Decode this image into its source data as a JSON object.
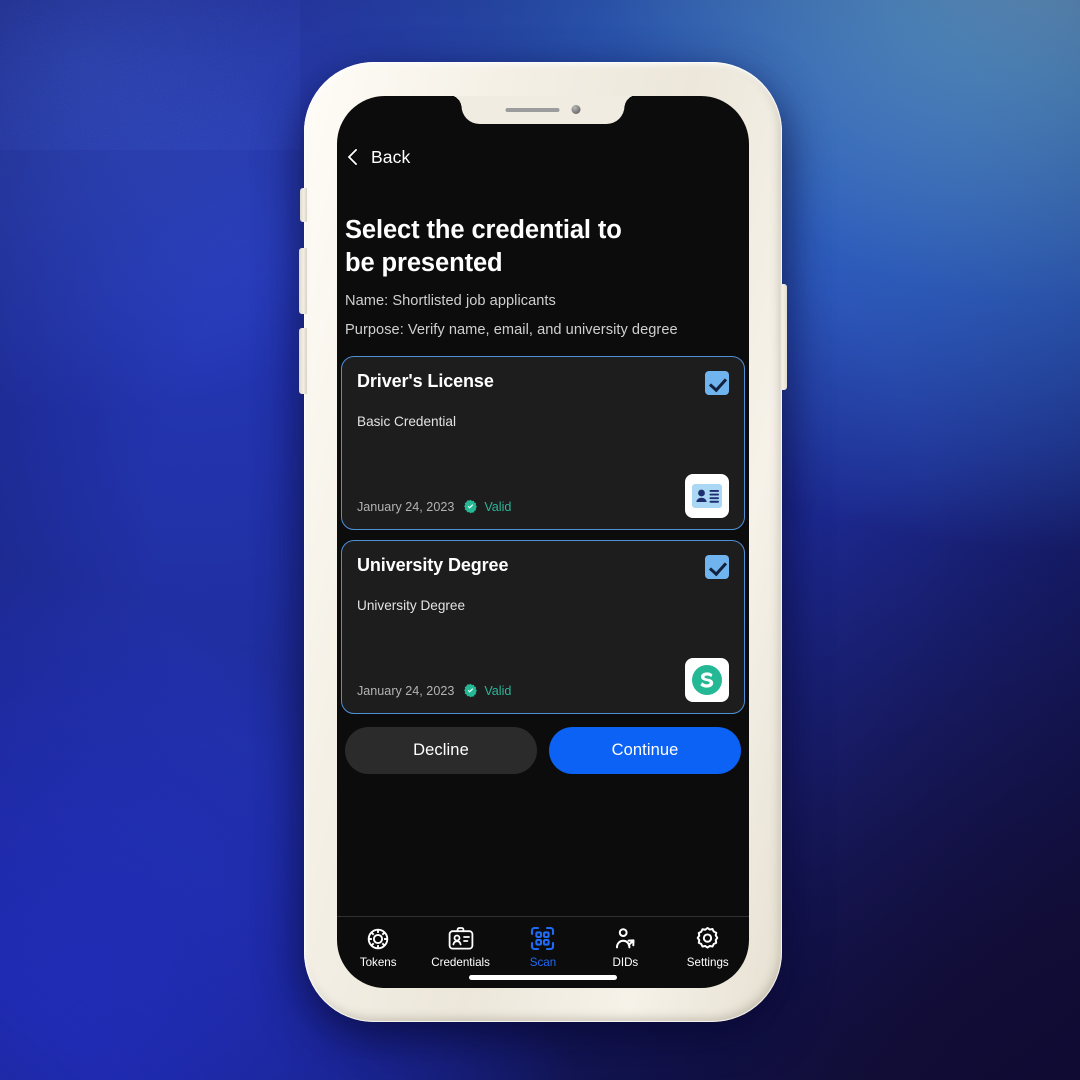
{
  "background": {
    "gradient_colors": [
      "#8fc6ef",
      "#2f5fc0",
      "#2f44f5",
      "#1d2a92",
      "#140d40"
    ]
  },
  "device": {
    "frame_color": "#f1ece1",
    "screen_color": "#0c0c0c",
    "notch": {
      "speaker_name": "earpiece-speaker",
      "camera_name": "front-camera"
    },
    "buttons": [
      "silent-switch",
      "volume-up",
      "volume-down",
      "power"
    ],
    "home_indicator": true
  },
  "screen": {
    "nav": {
      "back_label": "Back",
      "back_icon": "chevron-left-icon"
    },
    "heading": "Select the credential to be presented",
    "request": {
      "name_line": "Name: Shortlisted job applicants",
      "purpose_line": "Purpose: Verify name, email, and university degree"
    },
    "credentials": [
      {
        "title": "Driver's License",
        "subtitle": "Basic Credential",
        "date": "January 24, 2023",
        "status": "Valid",
        "status_icon": "verified-badge-icon",
        "selected": true,
        "logo_icon": "id-card-icon",
        "logo_colors": {
          "card": "#aad7f4",
          "ink": "#1e2f6f",
          "background": "#ffffff"
        }
      },
      {
        "title": "University Degree",
        "subtitle": "University Degree",
        "date": "January 24, 2023",
        "status": "Valid",
        "status_icon": "verified-badge-icon",
        "selected": true,
        "logo_icon": "sphereon-s-logo-icon",
        "logo_colors": {
          "mark": "#24b894",
          "background": "#ffffff"
        }
      }
    ],
    "actions": {
      "decline_label": "Decline",
      "continue_label": "Continue",
      "decline_color": "#2b2b2b",
      "continue_color": "#0b62f4"
    },
    "tabbar": {
      "active_color": "#1f6bf5",
      "inactive_color": "#ffffff",
      "items": [
        {
          "label": "Tokens",
          "icon": "poker-chip-icon",
          "active": false
        },
        {
          "label": "Credentials",
          "icon": "id-badge-icon",
          "active": false
        },
        {
          "label": "Scan",
          "icon": "qr-scan-icon",
          "active": true
        },
        {
          "label": "DIDs",
          "icon": "person-arrow-icon",
          "active": false
        },
        {
          "label": "Settings",
          "icon": "gear-icon",
          "active": false
        }
      ]
    },
    "colors": {
      "card_background": "#1d1d1d",
      "card_border": "#4e8fd6",
      "checkbox": "#6fb4ef",
      "valid_text": "#2ab69a"
    }
  }
}
